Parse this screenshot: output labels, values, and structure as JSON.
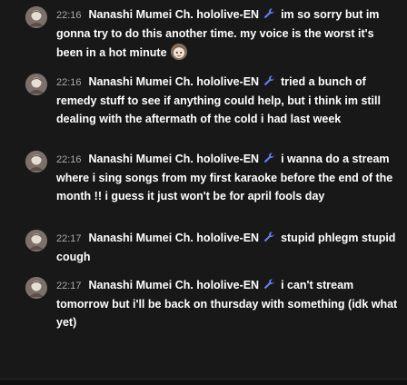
{
  "chat": {
    "messages": [
      {
        "time": "22:16",
        "author": "Nanashi Mumei Ch. hololive-EN",
        "badge_icon": "moderator-wrench-icon",
        "text": "im so sorry but im gonna try to do this another time. my voice is the worst it's been in a hot minute",
        "emoji_icon": "mumei-emote-icon"
      },
      {
        "time": "22:16",
        "author": "Nanashi Mumei Ch. hololive-EN",
        "badge_icon": "moderator-wrench-icon",
        "text": "tried a bunch of remedy stuff to see if anything could help, but i think im still dealing with the aftermath of the cold i had last week"
      },
      {
        "time": "22:16",
        "author": "Nanashi Mumei Ch. hololive-EN",
        "badge_icon": "moderator-wrench-icon",
        "text": "i wanna do a stream where i sing songs from my first karaoke before the end of the month !! i guess it just won't be for april fools day"
      },
      {
        "time": "22:17",
        "author": "Nanashi Mumei Ch. hololive-EN",
        "badge_icon": "moderator-wrench-icon",
        "text": "stupid phlegm stupid cough"
      },
      {
        "time": "22:17",
        "author": "Nanashi Mumei Ch. hololive-EN",
        "badge_icon": "moderator-wrench-icon",
        "text": "i can't stream tomorrow but i'll be back on thursday with something (idk what yet)"
      }
    ]
  },
  "colors": {
    "background": "#181818",
    "text": "#ffffff",
    "timestamp": "#aaaaaa"
  }
}
